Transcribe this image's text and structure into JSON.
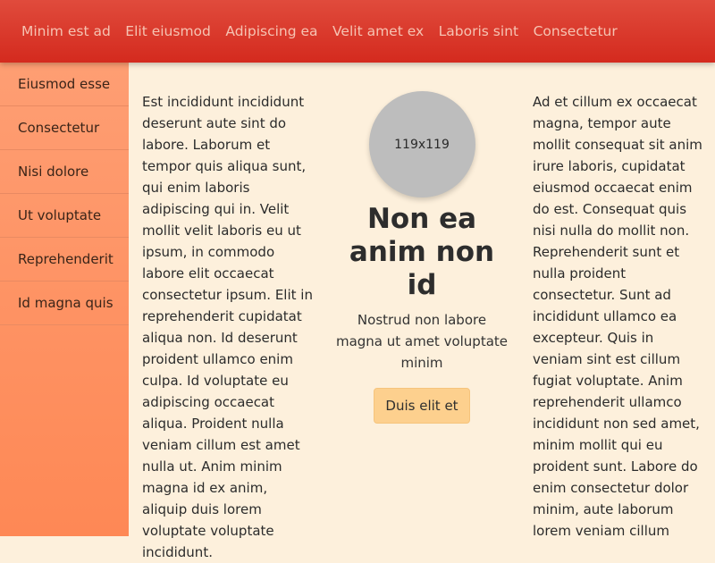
{
  "nav": {
    "links": [
      "Minim est ad",
      "Elit eiusmod",
      "Adipiscing ea",
      "Velit amet ex",
      "Laboris sint",
      "Consectetur"
    ]
  },
  "sidebar": {
    "items": [
      "Eiusmod esse",
      "Consectetur",
      "Nisi dolore",
      "Ut voluptate",
      "Reprehenderit",
      "Id magna quis"
    ]
  },
  "left_text": "Est incididunt incididunt deserunt aute sint do labore. Laborum et tempor quis aliqua sunt, qui enim laboris adipiscing qui in. Velit mollit velit laboris eu ut ipsum, in commodo labore elit occaecat consectetur ipsum. Elit in reprehenderit cupidatat aliqua non. Id deserunt proident ullamco enim culpa. Id voluptate eu adipiscing occaecat aliqua. Proident nulla veniam cillum est amet nulla ut. Anim minim magna id ex anim, aliquip duis lorem voluptate voluptate incididunt.",
  "center": {
    "avatar_label": "119x119",
    "title": "Non ea anim non id",
    "subtitle": "Nostrud non labore magna ut amet voluptate minim",
    "button_label": "Duis elit et"
  },
  "right_text": "Ad et cillum ex occaecat magna, tempor aute mollit consequat sit anim irure laboris, cupidatat eiusmod occaecat enim do est. Consequat quis nisi nulla do mollit non. Reprehenderit sunt et nulla proident consectetur. Sunt ad incididunt ullamco ea excepteur. Quis in veniam sint est cillum fugiat voluptate. Anim reprehenderit ullamco incididunt non sed amet, minim mollit qui eu proident sunt. Labore do enim consectetur dolor minim, aute laborum lorem veniam cillum"
}
